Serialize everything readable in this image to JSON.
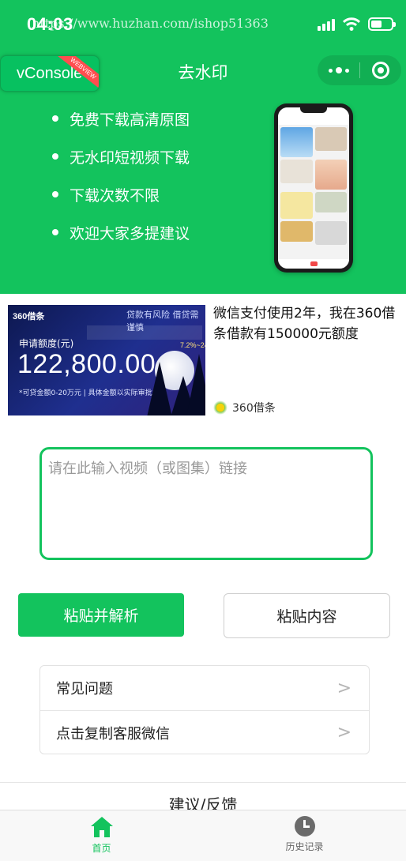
{
  "status_bar": {
    "time": "04:03",
    "watermark": "https://www.huzhan.com/ishop51363",
    "icons": [
      "signal-icon",
      "wifi-icon",
      "battery-icon"
    ]
  },
  "debug": {
    "vconsole_label": "vConsole",
    "ribbon": "WEBVIEW"
  },
  "nav": {
    "title": "去水印",
    "capsule_icons": [
      "more-icon",
      "close-mini-program-icon"
    ]
  },
  "features": [
    "免费下载高清原图",
    "无水印短视频下载",
    "下载次数不限",
    "欢迎大家多提建议"
  ],
  "ad": {
    "banner": {
      "logo": "360借条",
      "tag": "贷款有风险 借贷需谨慎",
      "rate": "7.2%~24%",
      "label": "申请额度(元)",
      "amount": "122,800.00",
      "note": "*可贷金额0-20万元 | 具体金额以实际审批为准"
    },
    "title": "微信支付使用2年，我在360借条借款有150000元额度",
    "brand": "360借条"
  },
  "link_input": {
    "value": "",
    "placeholder": "请在此输入视频（或图集）链接"
  },
  "buttons": {
    "parse": "粘贴并解析",
    "paste": "粘贴内容"
  },
  "menu": [
    {
      "label": "常见问题",
      "chevron": ">"
    },
    {
      "label": "点击复制客服微信",
      "chevron": ">"
    }
  ],
  "feedback": "建议/反馈",
  "tabbar": [
    {
      "label": "首页",
      "icon": "home-icon",
      "active": true
    },
    {
      "label": "历史记录",
      "icon": "clock-icon",
      "active": false
    }
  ],
  "colors": {
    "brand_green": "#13c35d",
    "text": "#222222",
    "muted": "#999999"
  }
}
